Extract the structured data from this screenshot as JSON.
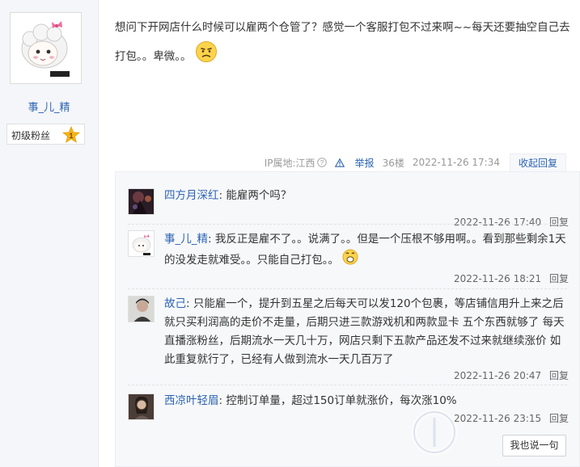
{
  "author": {
    "name": "事_儿_精",
    "rank": "初级粉丝",
    "rank_level": "1"
  },
  "post": {
    "text": "想问下开网店什么时候可以雇两个仓管了？感觉一个客服打包不过来啊~~每天还要抽空自己去打包。。卑微。。",
    "emoji": "frown-face-icon"
  },
  "meta": {
    "ip_label": "IP属地:江西",
    "report": "举报",
    "floor": "36楼",
    "time": "2022-11-26 17:34",
    "collapse": "收起回复"
  },
  "replies": [
    {
      "user": "四方月深红",
      "text": "能雇两个吗？",
      "time": "2022-11-26 17:40",
      "action": "回复"
    },
    {
      "user": "事_儿_精",
      "text": "我反正是雇不了。。说满了。。但是一个压根不够用啊。。看到那些剩余1天的没发走就难受。。只能自己打包。。",
      "time": "2022-11-26 18:21",
      "action": "回复"
    },
    {
      "user": "故己",
      "text": "只能雇一个，提升到五星之后每天可以发120个包裹，等店铺信用升上来之后就只买利润高的走价不走量，后期只进三款游戏机和两款显卡 五个东西就够了 每天直播涨粉丝，后期流水一天几十万，网店只剩下五款产品还发不过来就继续涨价 如此重复就行了，已经有人做到流水一天几百万了",
      "time": "2022-11-26 20:47",
      "action": "回复"
    },
    {
      "user": "西凉叶轻眉",
      "text": "控制订单量，超过150订单就涨价，每次涨10%",
      "time": "2022-11-26 23:15",
      "action": "回复"
    }
  ],
  "say_button": "我也说一句",
  "colors": {
    "link": "#2d64b3",
    "side_bg": "#f4f6f9",
    "reply_bg": "#f7f8fa",
    "badge": "#f5b417"
  }
}
